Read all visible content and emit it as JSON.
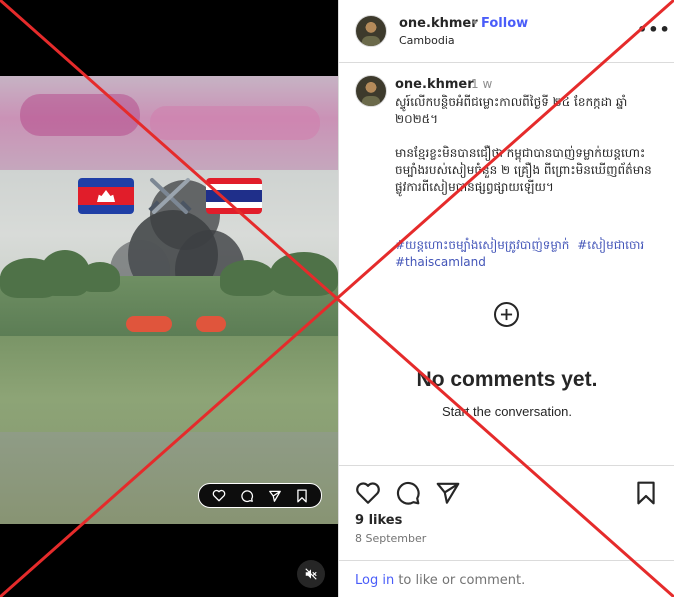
{
  "post": {
    "username": "one.khmer",
    "follow_label": "Follow",
    "location": "Cambodia",
    "more_label": "•••",
    "time_ago": "1 w",
    "caption_paragraph_1": "ស្ទូរ៍លើកបន្ថិចអំពីជម្លោះកាលពីថ្ងៃទី ២៤ ខែកក្កដា ឆ្នាំ ២០២៥។",
    "caption_paragraph_2": "មានខ្មែរខ្លះមិនបានជឿថា កម្ពុជាបានបាញ់ទម្លាក់យន្តហោះចម្បាំងរបស់សៀមចំនួន ២ គ្រឿង ពីព្រោះមិនឃើញព័ត៌មានផ្លូវការពីសៀមបានផ្សព្វផ្សាយឡើយ។",
    "hashtags": [
      "#យន្តហោះចម្បាំងសៀមត្រូវបាញ់ទម្លាក់",
      "#សៀមជាចោរ",
      "#thaiscamland"
    ],
    "empty_title": "No comments yet.",
    "empty_subtitle": "Start the conversation.",
    "likes": "9 likes",
    "date": "8 September",
    "login_link": "Log in",
    "login_rest": " to like or comment."
  },
  "overlay": {
    "x_color": "#e52b2b"
  },
  "icons": {
    "pill": [
      "heart-icon",
      "comment-icon",
      "share-icon",
      "bookmark-icon"
    ],
    "mute": "speaker-muted-icon",
    "actions": [
      "heart-icon",
      "comment-icon",
      "share-icon",
      "bookmark-icon"
    ],
    "plus": "add-comment-icon"
  }
}
